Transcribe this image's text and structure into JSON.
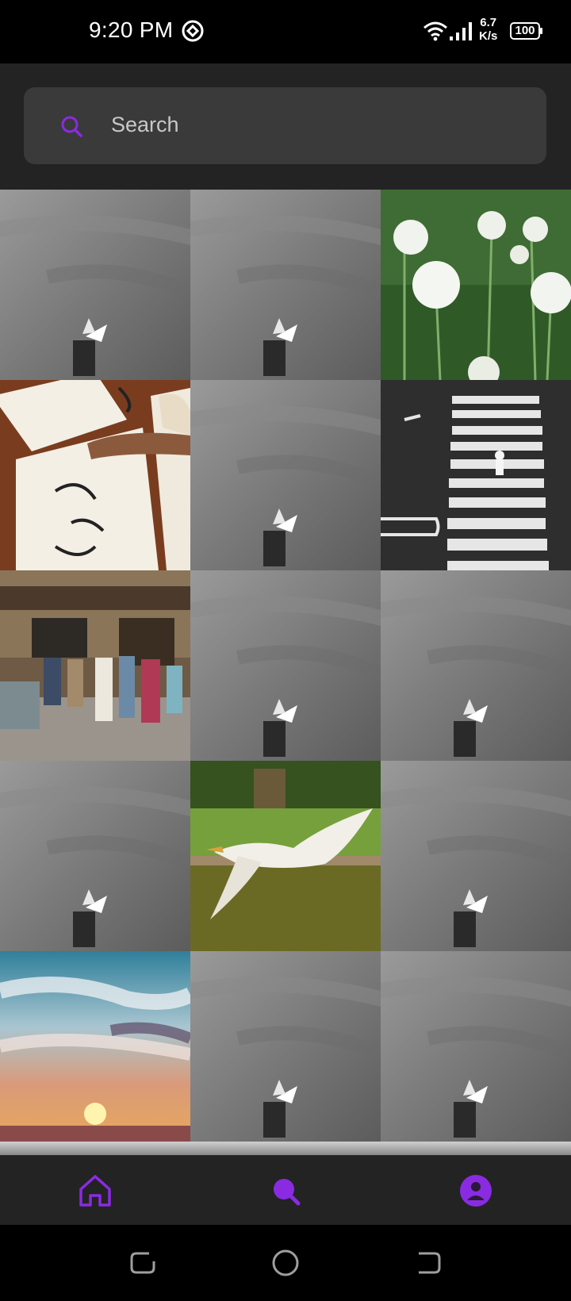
{
  "status_bar": {
    "time": "9:20 PM",
    "speed_value": "6.7",
    "speed_unit": "K/s",
    "battery": "100",
    "icons": [
      "app-notification-icon",
      "wifi-icon",
      "signal-icon",
      "battery-icon"
    ]
  },
  "search": {
    "placeholder": "Search"
  },
  "grid": {
    "tiles": [
      {
        "subject": "Gull on post over water (grayscale)"
      },
      {
        "subject": "Gull on post over water (grayscale)"
      },
      {
        "subject": "White allium flowers"
      },
      {
        "subject": "Person sitting on drawings"
      },
      {
        "subject": "Gull on post over water (grayscale)"
      },
      {
        "subject": "Crosswalk with pedestrian (black and white)"
      },
      {
        "subject": "Street scene with people"
      },
      {
        "subject": "Gull on post over water (grayscale)"
      },
      {
        "subject": "Gull on post over water (grayscale)"
      },
      {
        "subject": "Gull on post over water (grayscale)"
      },
      {
        "subject": "Swan in flight over water"
      },
      {
        "subject": "Gull on post over water (grayscale)"
      },
      {
        "subject": "Sunset sky with clouds"
      },
      {
        "subject": "Gull on post over water (grayscale)"
      },
      {
        "subject": "Gull on post over water (grayscale)"
      }
    ]
  },
  "bottom_nav": {
    "items": [
      {
        "icon": "home-icon",
        "active": false
      },
      {
        "icon": "search-icon",
        "active": true
      },
      {
        "icon": "profile-icon",
        "active": false
      }
    ]
  },
  "colors": {
    "accent": "#8a2be2",
    "background": "#232323",
    "search_bg": "#3a3a3a"
  }
}
